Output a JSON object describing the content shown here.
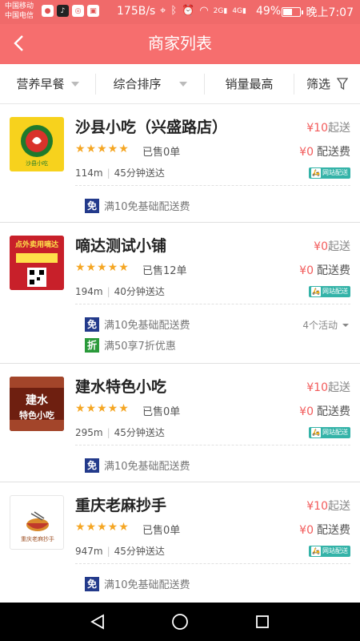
{
  "status_bar": {
    "carrier1": "中国移动",
    "carrier2": "中国电信",
    "speed": "175B/s",
    "battery": "49%",
    "battery_level": 0.49,
    "time": "晚上7:07",
    "network1": "2G",
    "network2": "4G"
  },
  "header": {
    "title": "商家列表",
    "back_icon": "chevron-left-icon"
  },
  "filters": {
    "category": "营养早餐",
    "sort": "综合排序",
    "sales": "销量最高",
    "filter": "筛选"
  },
  "merchants": [
    {
      "name": "沙县小吃（兴盛路店）",
      "min_order": "¥10",
      "min_order_suffix": "起送",
      "rating_stars": 5,
      "sold": "已售0单",
      "delivery_fee": "¥0",
      "delivery_fee_suffix": "配送费",
      "distance": "114m",
      "eta": "45分钟送达",
      "badge": "网站配送",
      "promos": [
        {
          "tag": "免",
          "text": "满10免基础配送费"
        }
      ],
      "logo_text": "沙县小吃",
      "logo_color": "#f7d21d"
    },
    {
      "name": "嘀达测试小铺",
      "min_order": "¥0",
      "min_order_suffix": "起送",
      "rating_stars": 5,
      "sold": "已售12单",
      "delivery_fee": "¥0",
      "delivery_fee_suffix": "配送费",
      "distance": "194m",
      "eta": "40分钟送达",
      "badge": "网站配送",
      "promos": [
        {
          "tag": "免",
          "text": "满10免基础配送费"
        },
        {
          "tag": "折",
          "text": "满50享7折优惠"
        }
      ],
      "activities": "4个活动",
      "logo_text": "点外卖用嘀达",
      "logo_color": "#d8323a"
    },
    {
      "name": "建水特色小吃",
      "min_order": "¥10",
      "min_order_suffix": "起送",
      "rating_stars": 5,
      "sold": "已售0单",
      "delivery_fee": "¥0",
      "delivery_fee_suffix": "配送费",
      "distance": "295m",
      "eta": "45分钟送达",
      "badge": "网站配送",
      "promos": [
        {
          "tag": "免",
          "text": "满10免基础配送费"
        }
      ],
      "logo_text": "建水特色小吃",
      "logo_color": "#8a2a18"
    },
    {
      "name": "重庆老麻抄手",
      "min_order": "¥10",
      "min_order_suffix": "起送",
      "rating_stars": 5,
      "sold": "已售0单",
      "delivery_fee": "¥0",
      "delivery_fee_suffix": "配送费",
      "distance": "947m",
      "eta": "45分钟送达",
      "badge": "网站配送",
      "promos": [
        {
          "tag": "免",
          "text": "满10免基础配送费"
        }
      ],
      "logo_text": "重庆老麻抄手",
      "logo_color": "#ffffff"
    }
  ],
  "nav": {
    "back": "triangle-back-icon",
    "home": "circle-home-icon",
    "recent": "square-recent-icon"
  },
  "colors": {
    "brand": "#f66e6e",
    "price_red": "#f25b5b",
    "star": "#f5a623",
    "badge_teal": "#34b3a8"
  }
}
